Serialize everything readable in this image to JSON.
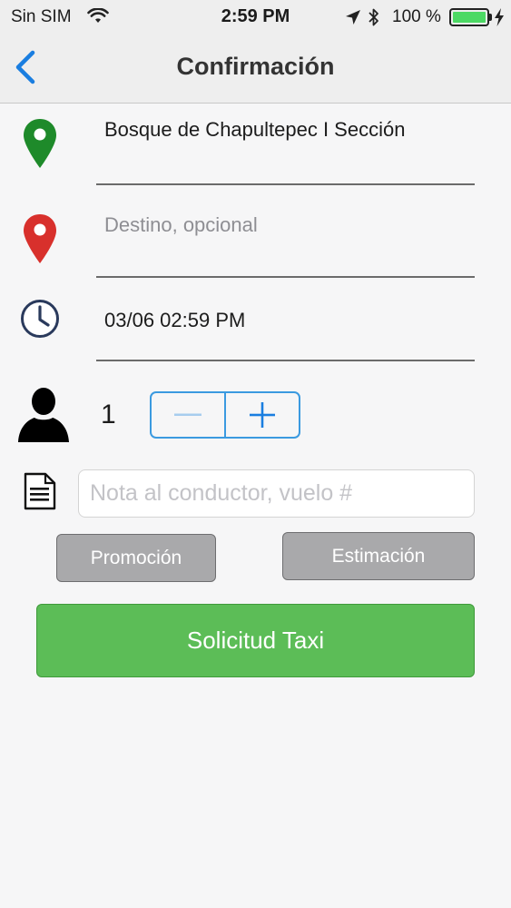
{
  "status_bar": {
    "carrier": "Sin SIM",
    "time": "2:59 PM",
    "battery": "100 %",
    "battery_color": "#4cd964"
  },
  "nav": {
    "title": "Confirmación",
    "back_icon": "chevron-left-icon",
    "accent": "#1a7ee0"
  },
  "form": {
    "origin": {
      "value": "Bosque de Chapultepec I Sección",
      "icon": "map-pin-green-icon",
      "icon_color": "#1e8a2a"
    },
    "destination": {
      "placeholder": "Destino, opcional",
      "icon": "map-pin-red-icon",
      "icon_color": "#d8302c"
    },
    "datetime": {
      "value": "03/06 02:59 PM",
      "icon": "clock-icon"
    },
    "passengers": {
      "count": "1",
      "icon": "person-icon",
      "decrement": "minus-icon",
      "increment": "plus-icon"
    },
    "note": {
      "placeholder": "Nota al conductor, vuelo #",
      "icon": "document-icon"
    }
  },
  "buttons": {
    "promo": "Promoción",
    "estimate": "Estimación",
    "request": "Solicitud Taxi",
    "request_color": "#5cbd57"
  }
}
